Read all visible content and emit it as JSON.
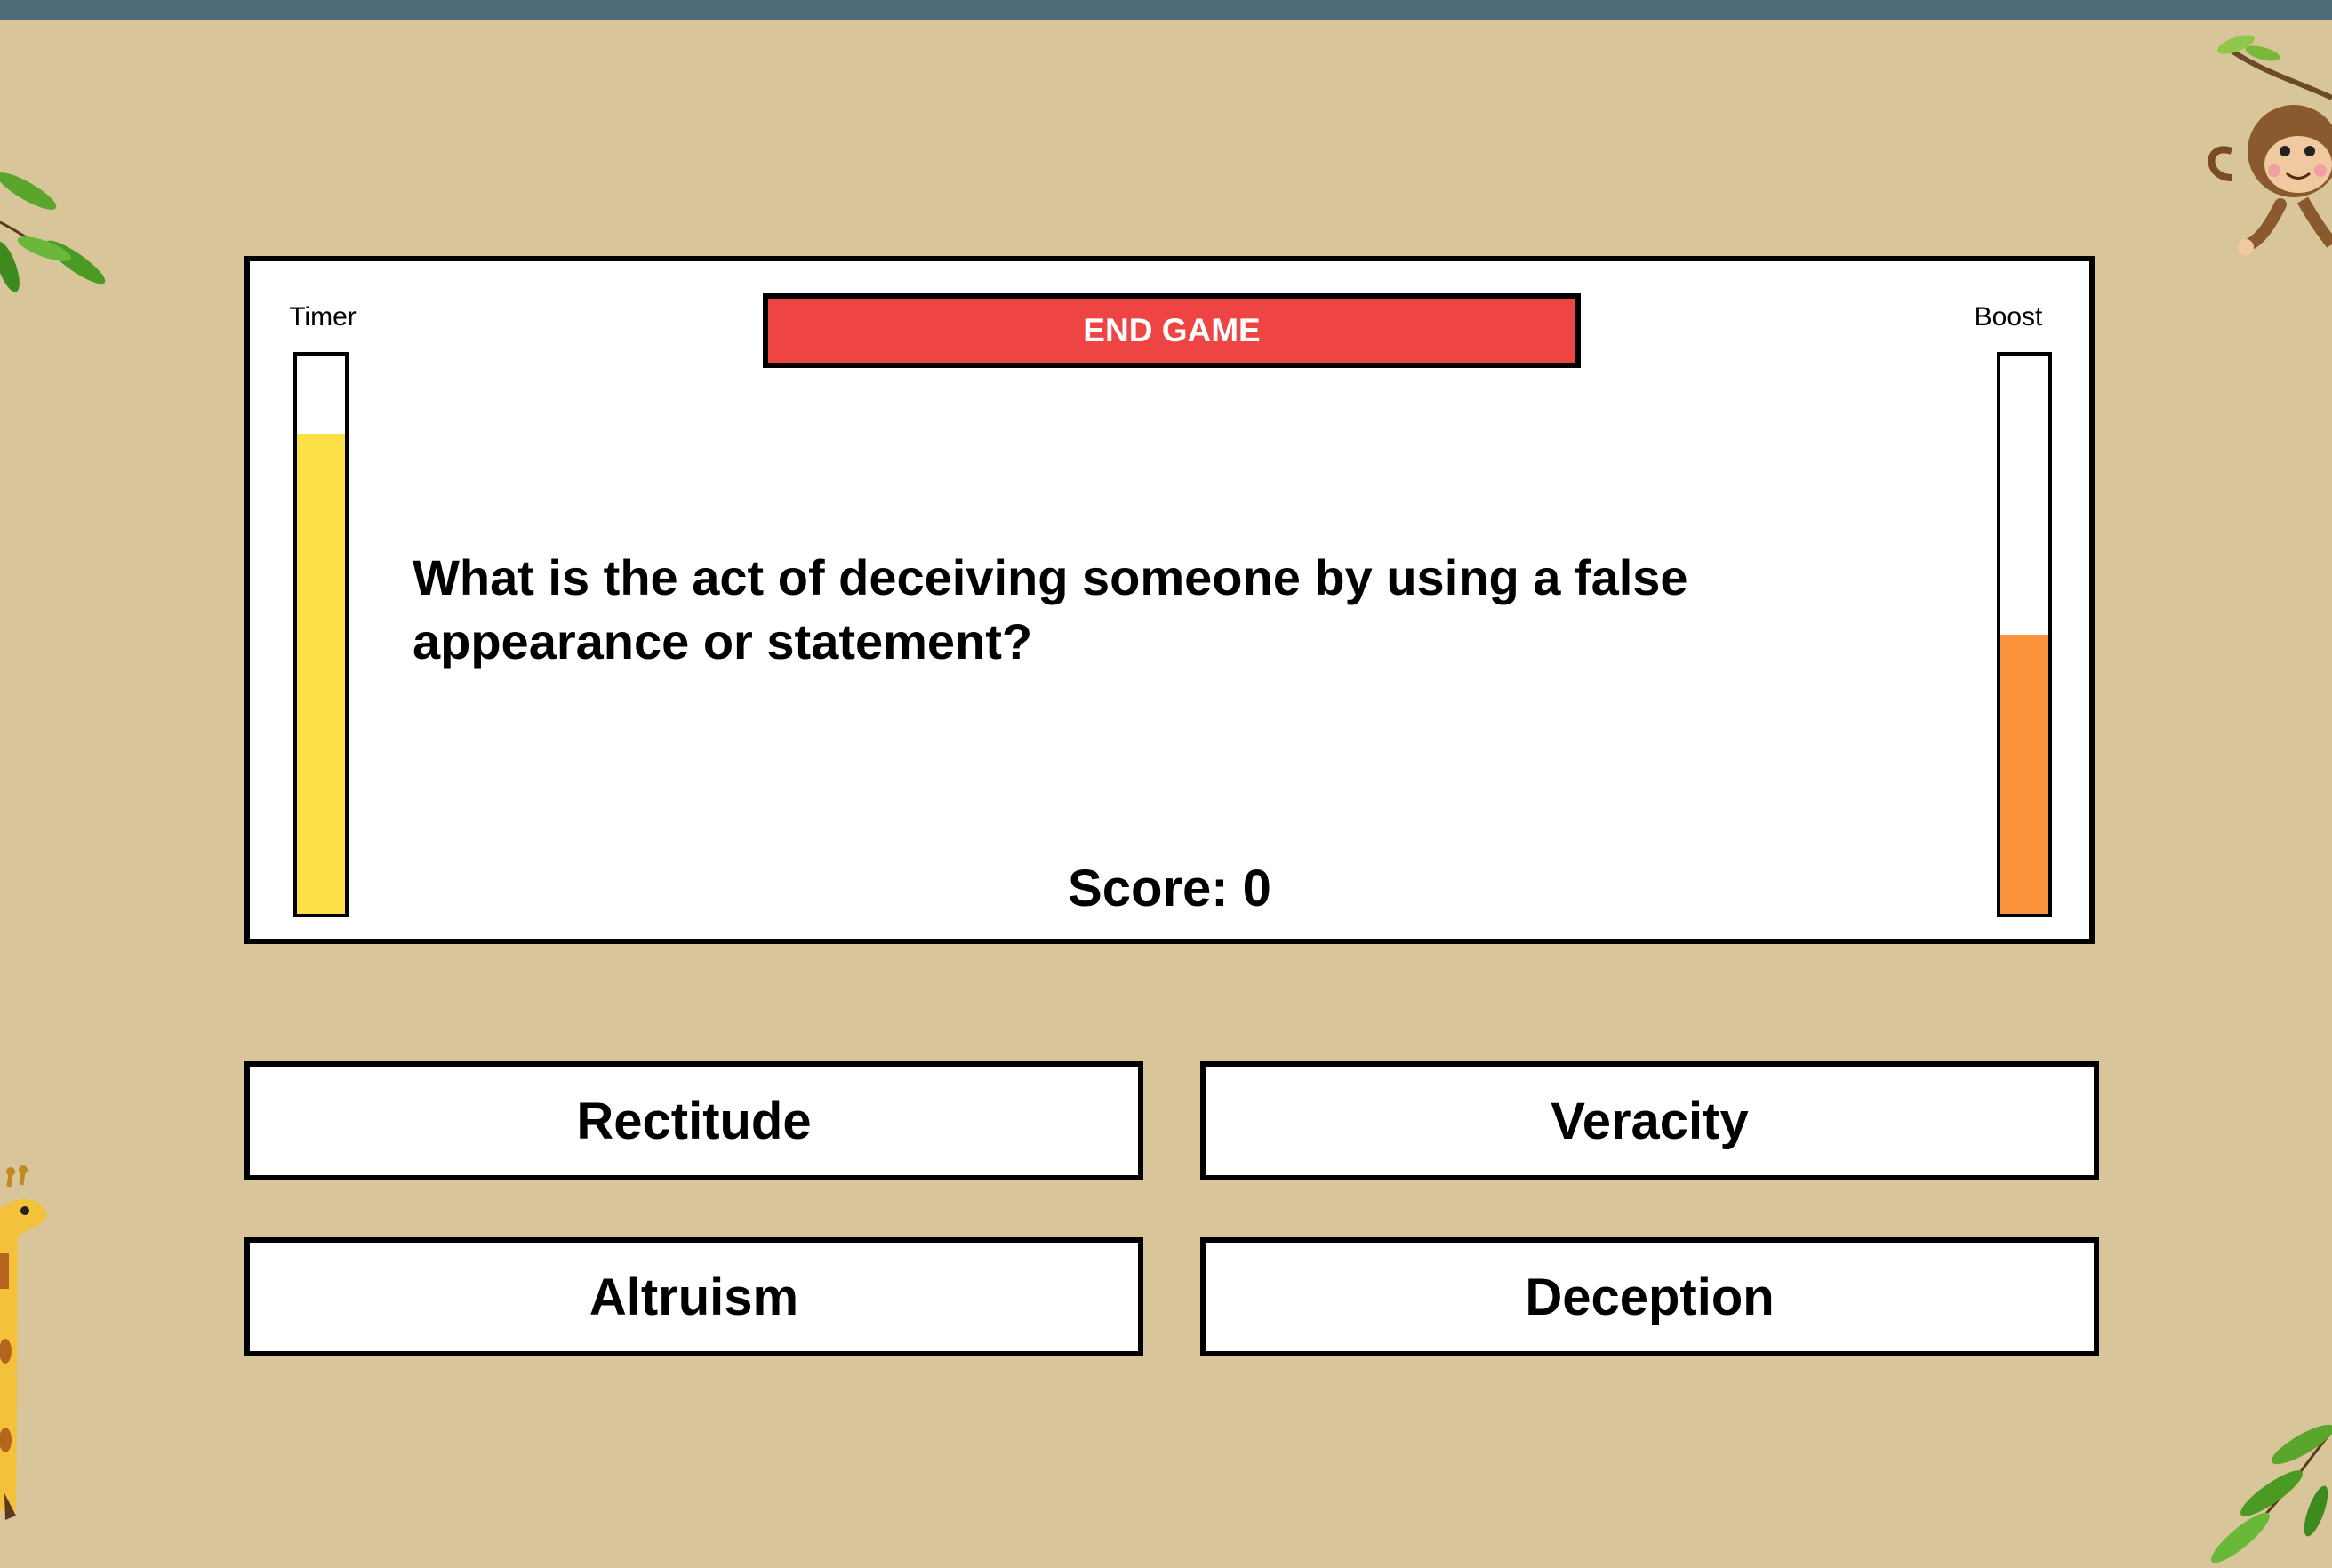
{
  "game": {
    "end_button_label": "END GAME",
    "question": "What is the act of deceiving someone by using a false appearance or statement?",
    "score_label": "Score: 0",
    "score": 0
  },
  "timer": {
    "label": "Timer",
    "level": 0.86,
    "color": "#fde047"
  },
  "boost": {
    "label": "Boost",
    "level": 0.5,
    "color": "#fb923c"
  },
  "answers": [
    {
      "label": "Rectitude"
    },
    {
      "label": "Veracity"
    },
    {
      "label": "Altruism"
    },
    {
      "label": "Deception"
    }
  ],
  "colors": {
    "background": "#d9c59a",
    "end_button": "#ef4444",
    "topbar": "#4f6b7a"
  },
  "decorations": [
    "leaf-branch-icon",
    "monkey-icon",
    "giraffe-icon",
    "leaf-branch-icon"
  ]
}
